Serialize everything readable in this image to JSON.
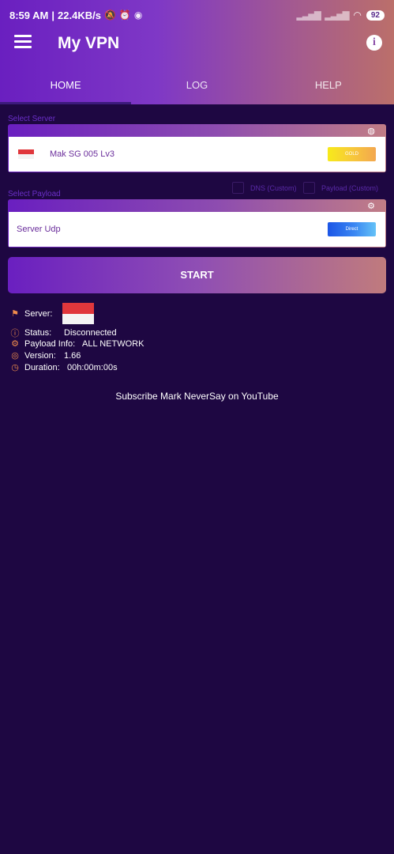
{
  "status_bar": {
    "time": "8:59 AM",
    "separator": "|",
    "speed": "22.4KB/s",
    "battery": "92"
  },
  "app": {
    "title": "My VPN"
  },
  "tabs": [
    {
      "label": "HOME",
      "active": true
    },
    {
      "label": "LOG",
      "active": false
    },
    {
      "label": "HELP",
      "active": false
    }
  ],
  "server_section": {
    "label": "Select Server",
    "server_name": "Mak SG 005 Lv3",
    "badge": "GOLD"
  },
  "payload_section": {
    "label": "Select Payload",
    "dns_checkbox_label": "DNS (Custom)",
    "payload_checkbox_label": "Payload (Custom)",
    "payload_name": "Server Udp",
    "badge": "Direct"
  },
  "start_button": {
    "label": "START"
  },
  "info": {
    "server_label": "Server:",
    "status_label": "Status:",
    "status_value": "Disconnected",
    "payload_label": "Payload Info:",
    "payload_value": "ALL NETWORK",
    "version_label": "Version:",
    "version_value": "1.66",
    "duration_label": "Duration:",
    "duration_value": "00h:00m:00s"
  },
  "footer": {
    "subscribe_text": "Subscribe Mark NeverSay on YouTube"
  },
  "icons": {
    "menu": "menu-icon",
    "info": "info-icon",
    "globe": "globe-icon",
    "settings": "gear-icon",
    "flag": "flag-icon"
  },
  "colors": {
    "background": "#1e0742",
    "header_start": "#6a1fc0",
    "header_end": "#bb6f6a",
    "accent_orange": "#f08c4c",
    "label_purple": "#6b2fc9"
  }
}
